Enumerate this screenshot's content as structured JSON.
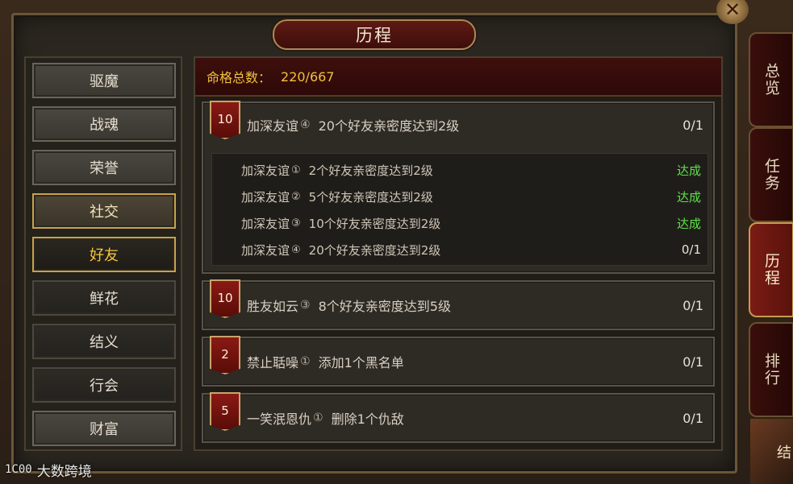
{
  "window": {
    "title": "历程",
    "close_icon": "close-icon"
  },
  "left_nav": {
    "items": [
      {
        "label": "驱魔",
        "state": "normal"
      },
      {
        "label": "战魂",
        "state": "normal"
      },
      {
        "label": "荣誉",
        "state": "normal"
      },
      {
        "label": "社交",
        "state": "selected"
      },
      {
        "label": "好友",
        "state": "active"
      },
      {
        "label": "鲜花",
        "state": "dark"
      },
      {
        "label": "结义",
        "state": "dark"
      },
      {
        "label": "行会",
        "state": "dark"
      },
      {
        "label": "财富",
        "state": "normal"
      }
    ]
  },
  "header": {
    "label": "命格总数：",
    "value": "220/667"
  },
  "cards": [
    {
      "badge": "10",
      "name": "加深友谊",
      "circled": "④",
      "desc": "20个好友亲密度达到2级",
      "progress": "0/1",
      "expanded": true,
      "subitems": [
        {
          "name": "加深友谊",
          "circled": "①",
          "desc": "2个好友亲密度达到2级",
          "status": "达成"
        },
        {
          "name": "加深友谊",
          "circled": "②",
          "desc": "5个好友亲密度达到2级",
          "status": "达成"
        },
        {
          "name": "加深友谊",
          "circled": "③",
          "desc": "10个好友亲密度达到2级",
          "status": "达成"
        },
        {
          "name": "加深友谊",
          "circled": "④",
          "desc": "20个好友亲密度达到2级",
          "status": "0/1"
        }
      ]
    },
    {
      "badge": "10",
      "name": "胜友如云",
      "circled": "③",
      "desc": "8个好友亲密度达到5级",
      "progress": "0/1"
    },
    {
      "badge": "2",
      "name": "禁止聒噪",
      "circled": "①",
      "desc": "添加1个黑名单",
      "progress": "0/1"
    },
    {
      "badge": "5",
      "name": "一笑泯恩仇",
      "circled": "①",
      "desc": "删除1个仇敌",
      "progress": "0/1"
    }
  ],
  "right_tabs": [
    {
      "label": "总览",
      "active": false
    },
    {
      "label": "任务",
      "active": false
    },
    {
      "label": "历程",
      "active": true
    },
    {
      "label": "排行",
      "active": false
    }
  ],
  "watermark": {
    "logo": "1C00",
    "text": "大数跨境"
  },
  "corner_text": "结",
  "colors": {
    "done": "#5ee04a",
    "accent_gold": "#f0c040",
    "badge_red": "#8a1a14"
  }
}
